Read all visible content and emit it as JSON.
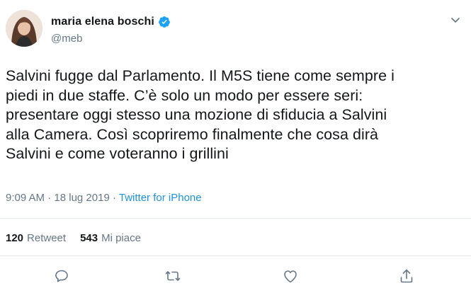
{
  "author": {
    "name": "maria elena boschi",
    "handle": "@meb",
    "verified": true,
    "avatar_icon": "profile-photo-icon"
  },
  "tweet": {
    "text": "Salvini fugge dal Parlamento. Il M5S tiene come sempre i\npiedi in due staffe. C’è solo un modo per essere seri:\npresentare oggi stesso una mozione di sfiducia a Salvini\nalla Camera. Così scopriremo finalmente che cosa dirà\nSalvini e come voteranno i grillini",
    "time": "9:09 AM",
    "separator": "·",
    "date": "18 lug 2019",
    "source": "Twitter for iPhone"
  },
  "stats": {
    "retweets_count": "120",
    "retweets_label": "Retweet",
    "likes_count": "543",
    "likes_label": "Mi piace"
  },
  "actions": [
    "reply-icon",
    "retweet-icon",
    "like-icon",
    "share-icon"
  ],
  "colors": {
    "text": "#14171a",
    "secondary": "#657786",
    "link": "#1b95e0",
    "verified": "#1da1f2",
    "divider": "#e6ecf0"
  }
}
